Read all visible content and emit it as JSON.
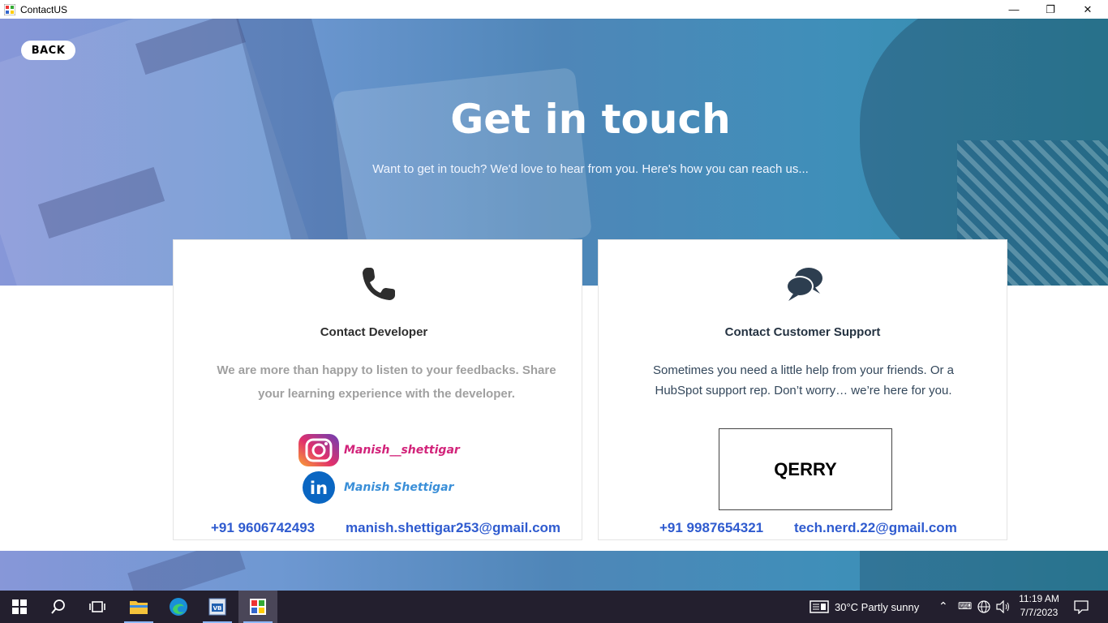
{
  "window": {
    "title": "ContactUS",
    "minimize_glyph": "—",
    "maximize_glyph": "❐",
    "close_glyph": "✕"
  },
  "hero": {
    "back_label": "BACK",
    "title": "Get in touch",
    "subtitle": "Want to get in touch? We'd love to hear from you. Here's how you can reach us..."
  },
  "developer_card": {
    "icon": "phone-icon",
    "heading": "Contact Developer",
    "description": "We are more than happy to listen to your feedbacks. Share your learning experience with the developer.",
    "instagram": "Manish__shettigar",
    "linkedin": "Manish Shettigar",
    "phone": "+91 9606742493",
    "email": "manish.shettigar253@gmail.com"
  },
  "support_card": {
    "icon": "chat-bubbles-icon",
    "heading": "Contact Customer Support",
    "description": "Sometimes you need a little help from your friends. Or a HubSpot support rep. Don’t worry… we’re here for you.",
    "query_button": "QERRY",
    "phone": "+91 9987654321",
    "email": "tech.nerd.22@gmail.com"
  },
  "taskbar": {
    "weather": "30°C  Partly sunny",
    "time": "11:19 AM",
    "date": "7/7/2023",
    "icons": [
      "windows-start-icon",
      "search-icon",
      "task-view-icon",
      "file-explorer-icon",
      "edge-icon",
      "visual-basic-icon",
      "contactus-app-icon"
    ]
  },
  "colors": {
    "hero_start": "#8797d8",
    "hero_end": "#2f8ea9",
    "link_blue": "#2f5bcf",
    "instagram_pink": "#d2237a",
    "linkedin_blue": "#3a8fd8",
    "taskbar_bg": "#231f2e"
  }
}
